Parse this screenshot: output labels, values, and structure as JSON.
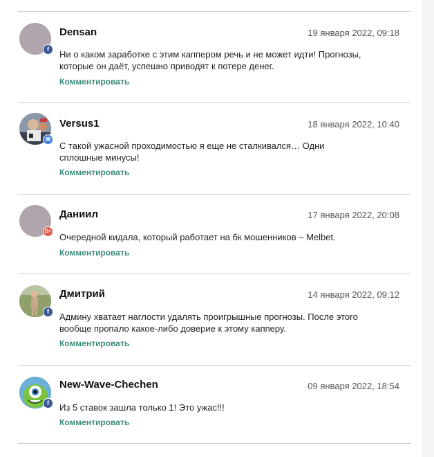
{
  "comments": [
    {
      "author": "Densan",
      "date": "19 января 2022, 09:18",
      "text": "Ни о каком заработке с этим каппером речь и не может идти! Прогнозы, которые он даёт, успешно приводят к потере денег.",
      "reply_label": "Комментировать",
      "network_icon": "facebook-icon",
      "avatar": "placeholder-avatar"
    },
    {
      "author": "Versus1",
      "date": "18 января 2022, 10:40",
      "text": "С такой ужасной проходимостью я еще не сталкивался… Одни сплошные минусы!",
      "reply_label": "Комментировать",
      "network_icon": "mail-icon",
      "avatar": "photo-avatar"
    },
    {
      "author": "Даниил",
      "date": "17 января 2022, 20:08",
      "text": "Очередной кидала, который работает на бк мошенников – Melbet.",
      "reply_label": "Комментировать",
      "network_icon": "google-plus-icon",
      "avatar": "placeholder-avatar"
    },
    {
      "author": "Дмитрий",
      "date": "14 января 2022, 09:12",
      "text": "Админу хватает наглости удалять проигрышные прогнозы. После этого вообще пропало какое-либо доверие к этому капперу.",
      "reply_label": "Комментировать",
      "network_icon": "facebook-icon",
      "avatar": "photo-avatar"
    },
    {
      "author": "New-Wave-Chechen",
      "date": "09 января 2022, 18:54",
      "text": "Из 5 ставок зашла только 1! Это ужас!!!",
      "reply_label": "Комментировать",
      "network_icon": "facebook-icon",
      "avatar": "cartoon-avatar"
    }
  ],
  "colors": {
    "reply_link": "#3c8a7c",
    "divider": "#cfcfcf",
    "placeholder_avatar": "#b0a4ad",
    "facebook": "#3b5998",
    "mail": "#3d7ee0",
    "google_plus": "#e25b4c"
  }
}
